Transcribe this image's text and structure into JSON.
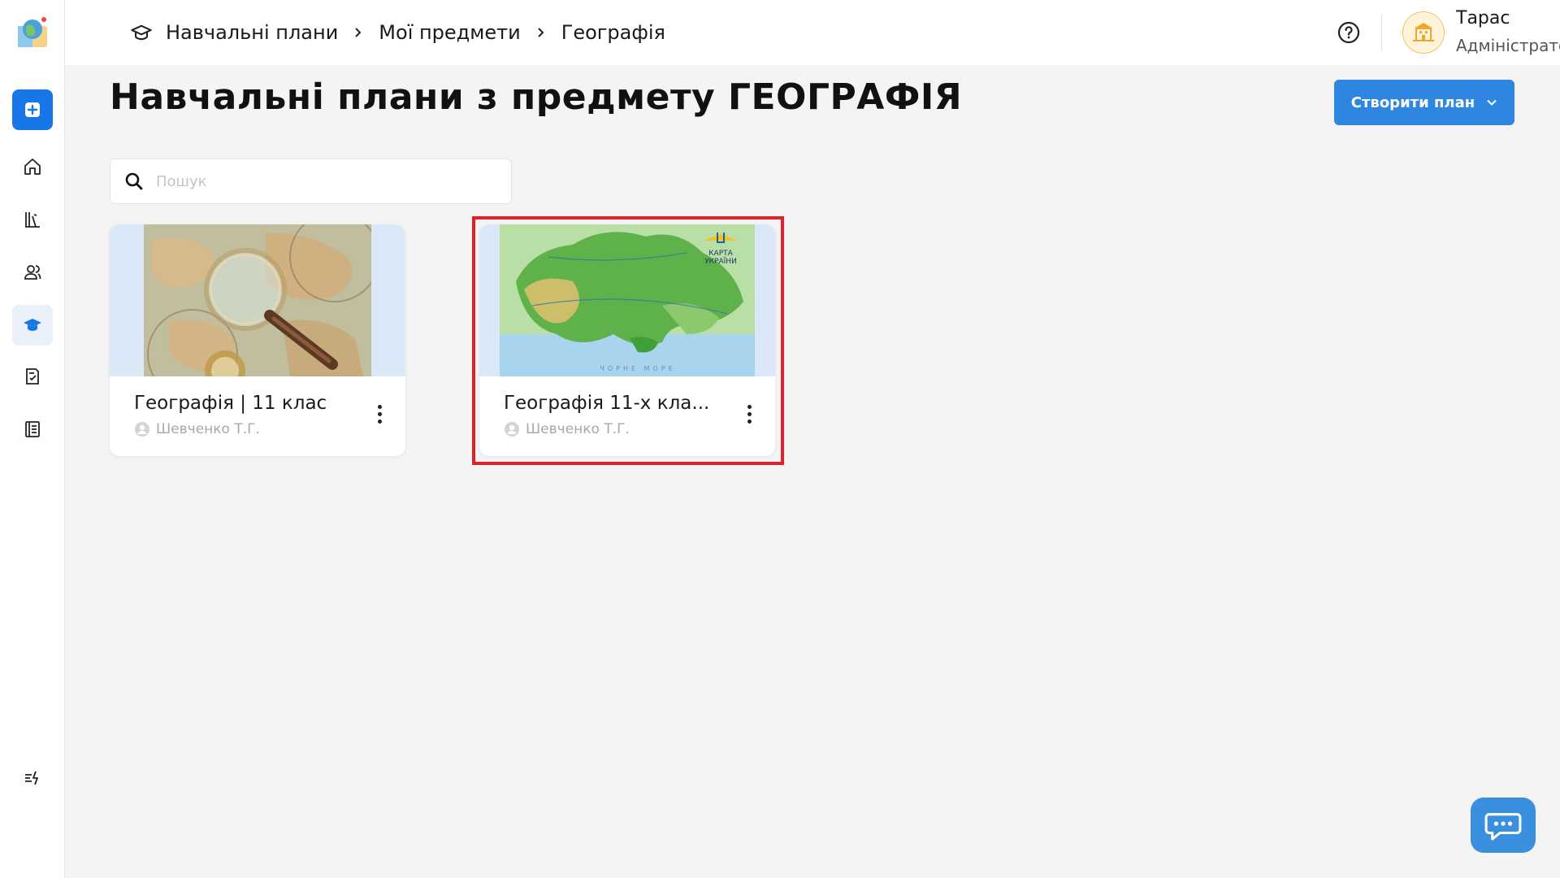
{
  "breadcrumb": {
    "items": [
      "Навчальні плани",
      "Мої предмети",
      "Географія"
    ]
  },
  "user": {
    "name": "Тарас",
    "role": "Адміністратор"
  },
  "page": {
    "title": "Навчальні плани з предмету ГЕОГРАФІЯ"
  },
  "actions": {
    "create_label": "Створити план"
  },
  "search": {
    "placeholder": "Пошук",
    "value": ""
  },
  "cards": [
    {
      "title": "Географія | 11 клас",
      "author": "Шевченко Т.Г.",
      "image": "antique-world-map-magnifier"
    },
    {
      "title": "Географія 11-х кла...",
      "author": "Шевченко Т.Г.",
      "image": "map-of-ukraine",
      "map_caption_1": "КАРТА",
      "map_caption_2": "УКРАЇНИ",
      "sea_label": "ЧОРНЕ МОРЕ"
    }
  ],
  "colors": {
    "accent": "#1877e8",
    "button": "#2f86e0",
    "highlight": "#e0202a",
    "background": "#f4f4f4"
  },
  "icons": {
    "sidebar": [
      "add-icon",
      "home-icon",
      "library-icon",
      "users-icon",
      "graduation-cap-icon",
      "assignment-icon",
      "journal-icon",
      "whats-new-icon"
    ],
    "header": [
      "graduation-cap-icon",
      "help-icon",
      "school-avatar-icon"
    ]
  }
}
